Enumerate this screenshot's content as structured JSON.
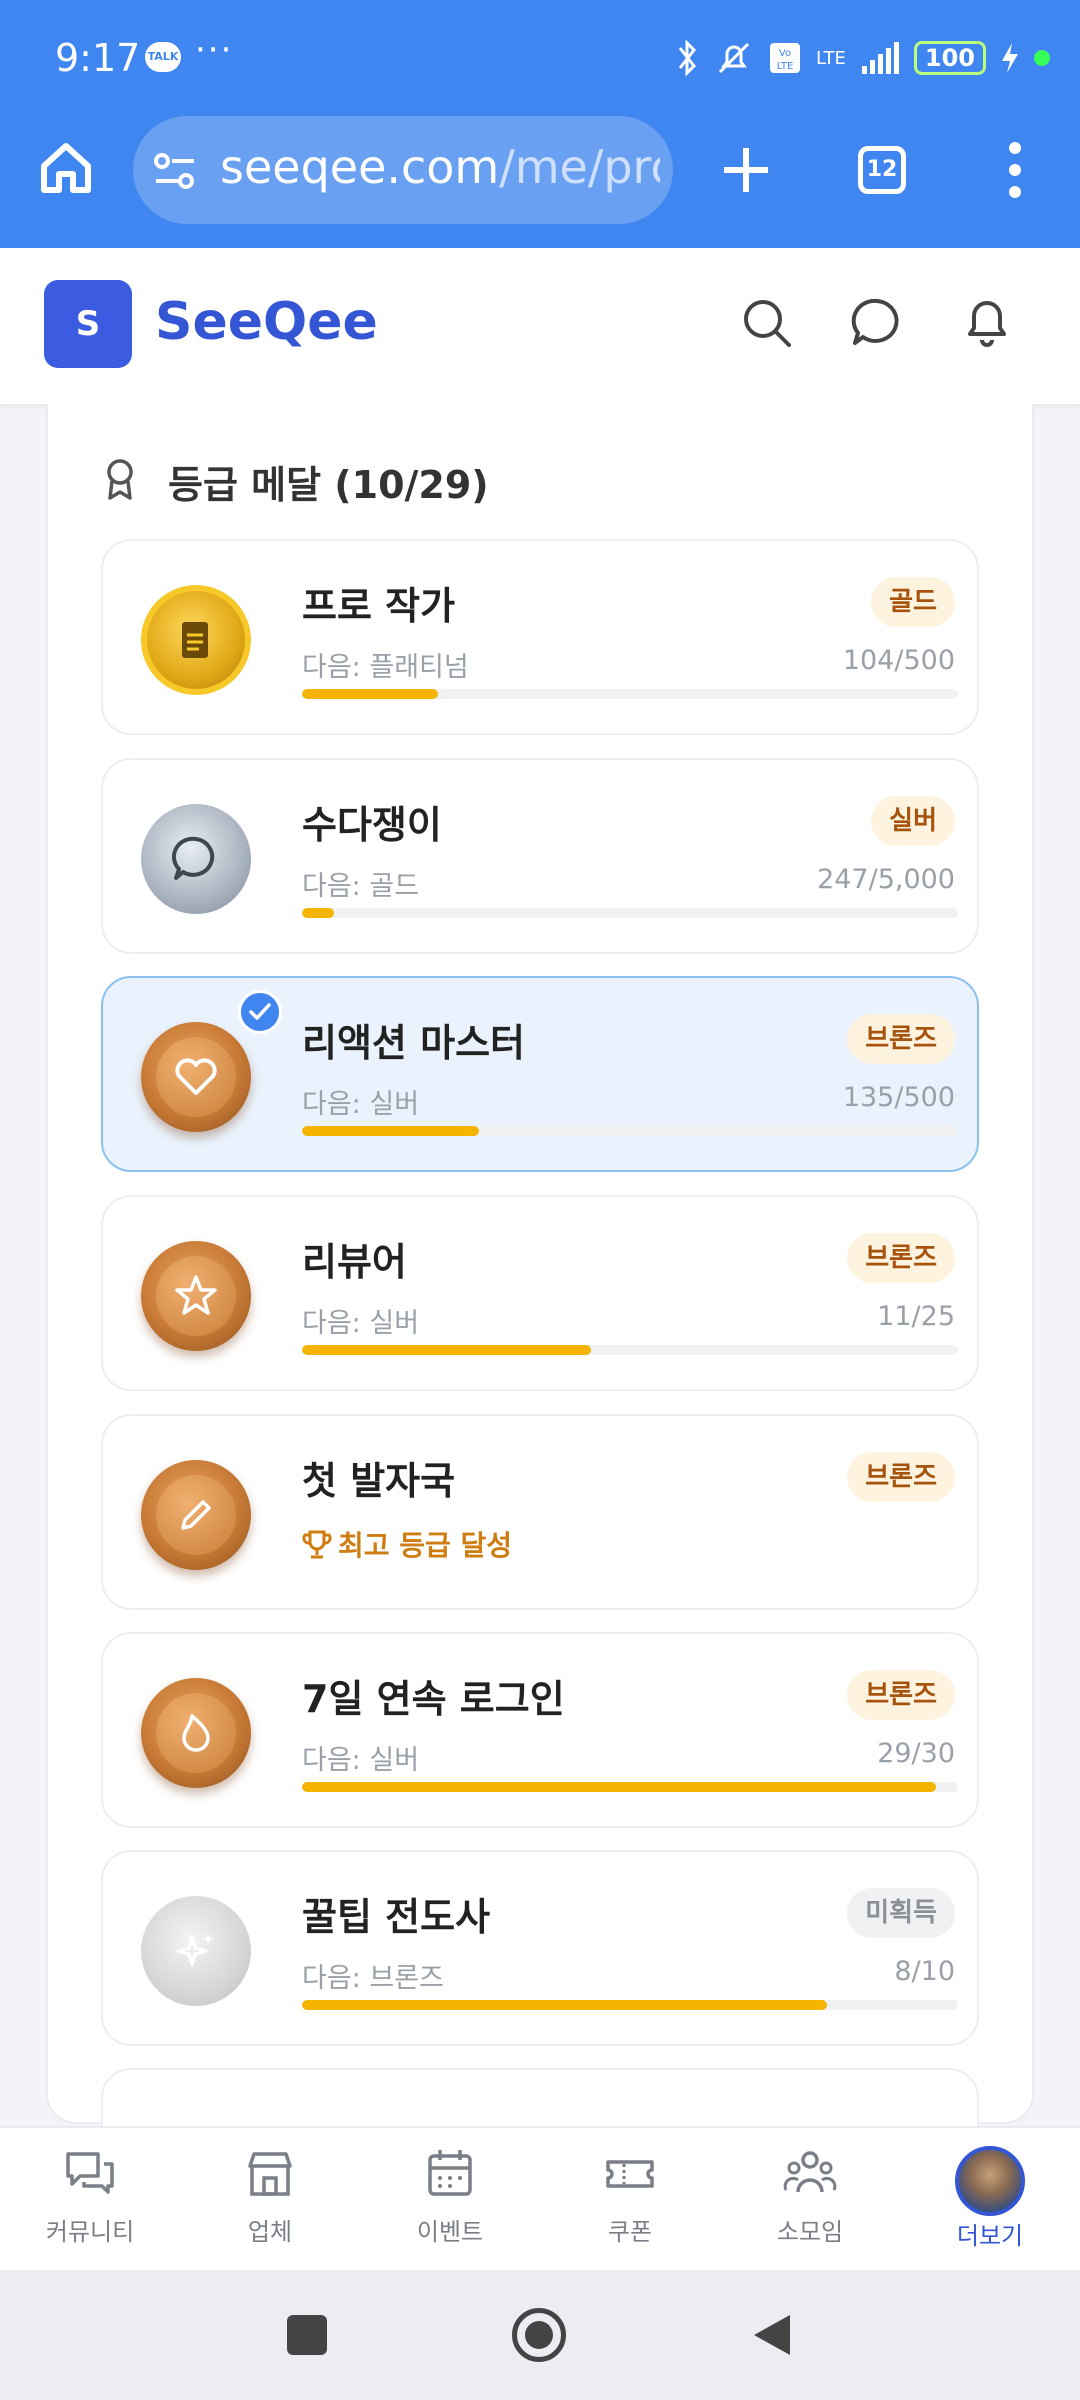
{
  "status_bar": {
    "time": "9:17",
    "talk": "TALK",
    "dots": "···",
    "battery": "100",
    "lte": "LTE"
  },
  "browser": {
    "url_main": "seeqee.com",
    "url_path": "/me/pro",
    "tabs": "12"
  },
  "header": {
    "logo_letter": "S",
    "brand": "SeeQee"
  },
  "section": {
    "title": "등급 메달 (10/29)"
  },
  "medals": [
    {
      "title": "프로 작가",
      "tier": "골드",
      "next": "다음: 플래티넘",
      "count": "104/500",
      "progress": 0.208
    },
    {
      "title": "수다쟁이",
      "tier": "실버",
      "next": "다음: 골드",
      "count": "247/5,000",
      "progress": 0.049
    },
    {
      "title": "리액션 마스터",
      "tier": "브론즈",
      "next": "다음: 실버",
      "count": "135/500",
      "progress": 0.27
    },
    {
      "title": "리뷰어",
      "tier": "브론즈",
      "next": "다음: 실버",
      "count": "11/25",
      "progress": 0.44
    },
    {
      "title": "첫 발자국",
      "tier": "브론즈",
      "achieved": "최고 등급 달성"
    },
    {
      "title": "7일 연속 로그인",
      "tier": "브론즈",
      "next": "다음: 실버",
      "count": "29/30",
      "progress": 0.967
    },
    {
      "title": "꿀팁 전도사",
      "tier": "미획득",
      "next": "다음: 브론즈",
      "count": "8/10",
      "progress": 0.8
    }
  ],
  "nav": {
    "community": "커뮤니티",
    "business": "업체",
    "event": "이벤트",
    "coupon": "쿠폰",
    "group": "소모임",
    "more": "더보기"
  },
  "colors": {
    "accent": "#3f86f0",
    "brand": "#3456d4",
    "progress": "#f4b400"
  }
}
